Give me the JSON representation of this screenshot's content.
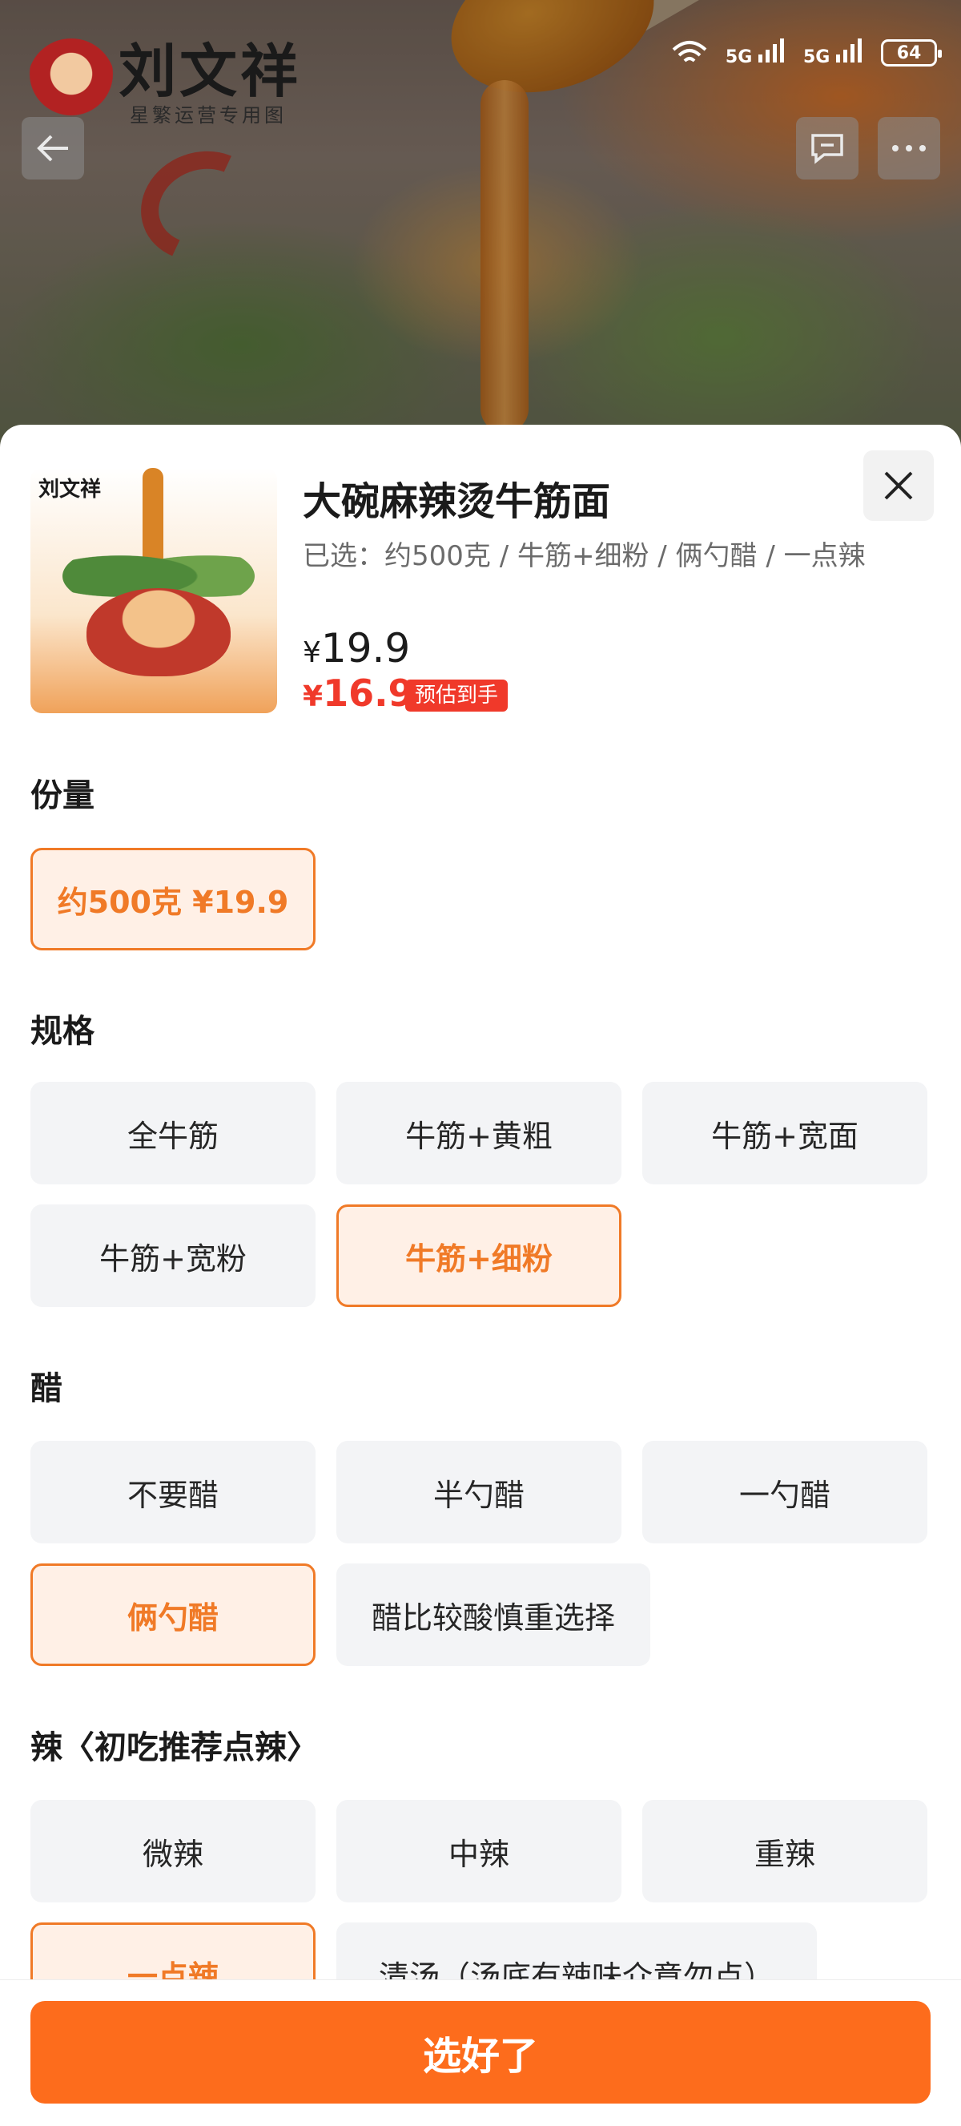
{
  "hero": {
    "logo_text": "刘文祥",
    "logo_sub": "星繁运营专用图"
  },
  "status_bar": {
    "signal_1": "5G",
    "signal_2": "5G",
    "battery": "64"
  },
  "product": {
    "title": "大碗麻辣烫牛筋面",
    "selected_summary": "已选：约500克 / 牛筋+细粉 / 俩勺醋 / 一点辣",
    "price_original": "19.9",
    "price_final": "16.9",
    "currency": "¥",
    "badge": "预估到手"
  },
  "sections": {
    "portion": {
      "title": "份量",
      "options": [
        "约500克  ¥19.9"
      ],
      "selected": "约500克  ¥19.9"
    },
    "spec": {
      "title": "规格",
      "options": [
        "全牛筋",
        "牛筋+黄粗",
        "牛筋+宽面",
        "牛筋+宽粉",
        "牛筋+细粉"
      ],
      "selected": "牛筋+细粉"
    },
    "vinegar": {
      "title": "醋",
      "options": [
        "不要醋",
        "半勺醋",
        "一勺醋",
        "俩勺醋",
        "醋比较酸慎重选择"
      ],
      "selected": "俩勺醋"
    },
    "spicy": {
      "title": "辣〈初吃推荐点辣〉",
      "options": [
        "微辣",
        "中辣",
        "重辣",
        "一点辣",
        "清汤（汤底有辣味介意勿点）"
      ],
      "selected": "一点辣"
    }
  },
  "footer": {
    "confirm_label": "选好了"
  },
  "colors": {
    "accent": "#fd6c1c",
    "selected_border": "#f07a27",
    "price_red": "#f0392a"
  }
}
